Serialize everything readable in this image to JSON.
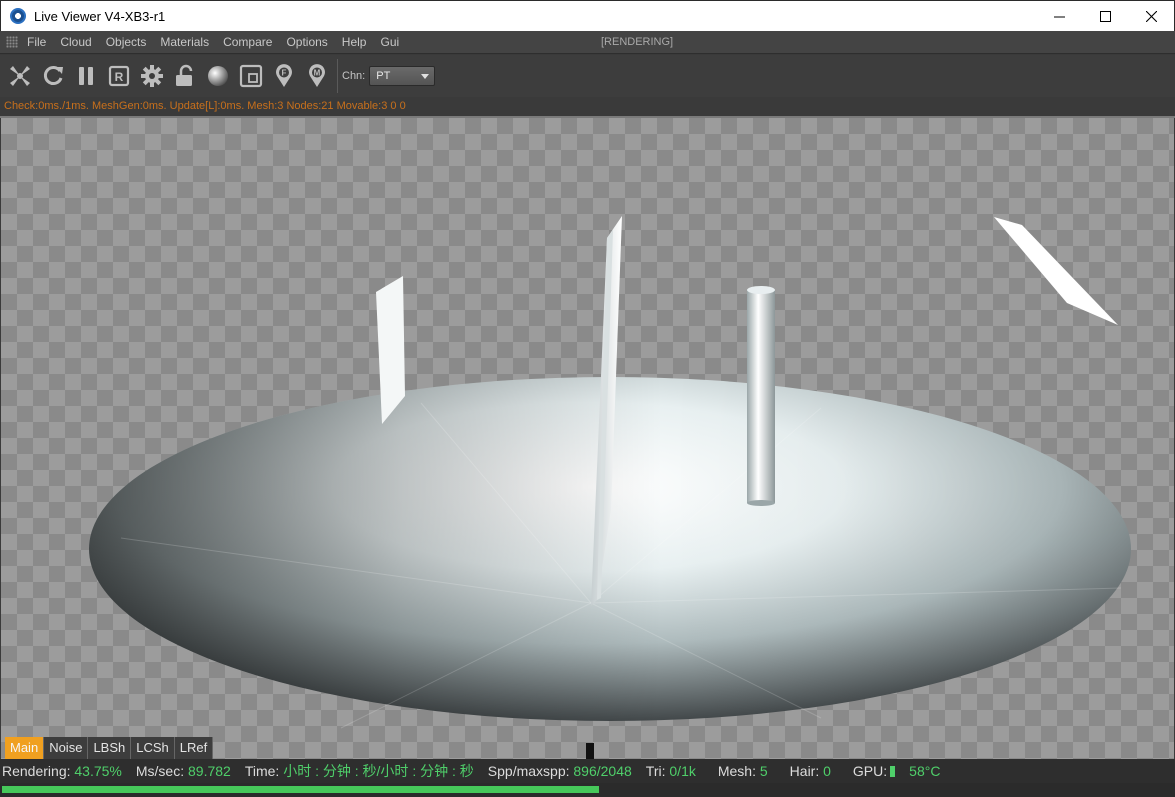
{
  "window": {
    "title": "Live Viewer V4-XB3-r1",
    "minimize_symbol": "—",
    "maximize_symbol": "☐",
    "close_symbol": "✕"
  },
  "menu": {
    "items": [
      "File",
      "Cloud",
      "Objects",
      "Materials",
      "Compare",
      "Options",
      "Help",
      "Gui"
    ],
    "status": "[RENDERING]"
  },
  "toolbar": {
    "icons": [
      "scissors-fan-icon",
      "reload-icon",
      "pause-icon",
      "region-r-icon",
      "settings-gear-icon",
      "unlock-icon",
      "material-sphere-icon",
      "focus-frame-icon",
      "pin-f-icon",
      "pin-m-icon"
    ],
    "channel_label": "Chn:",
    "channel_value": "PT"
  },
  "info_line": "Check:0ms./1ms. MeshGen:0ms. Update[L]:0ms. Mesh:3 Nodes:21 Movable:3 0 0",
  "render_tabs": [
    "Main",
    "Noise",
    "LBSh",
    "LCSh",
    "LRef"
  ],
  "active_tab": "Main",
  "status": {
    "rendering_label": "Rendering:",
    "rendering_value": "43.75%",
    "ms_label": "Ms/sec:",
    "ms_value": "89.782",
    "time_label": "Time:",
    "time_value": "小时 : 分钟 : 秒/小时 : 分钟 : 秒",
    "spp_label": "Spp/maxspp:",
    "spp_value": "896/2048",
    "tri_label": "Tri:",
    "tri_value": "0/1k",
    "mesh_label": "Mesh:",
    "mesh_value": "5",
    "hair_label": "Hair:",
    "hair_value": "0",
    "gpu_label": "GPU:",
    "gpu_value": "58°C"
  },
  "progress": 0.4375,
  "colors": {
    "accent_tab": "#f0a020",
    "status_value": "#4fcf6a",
    "info_text": "#c8701c"
  }
}
